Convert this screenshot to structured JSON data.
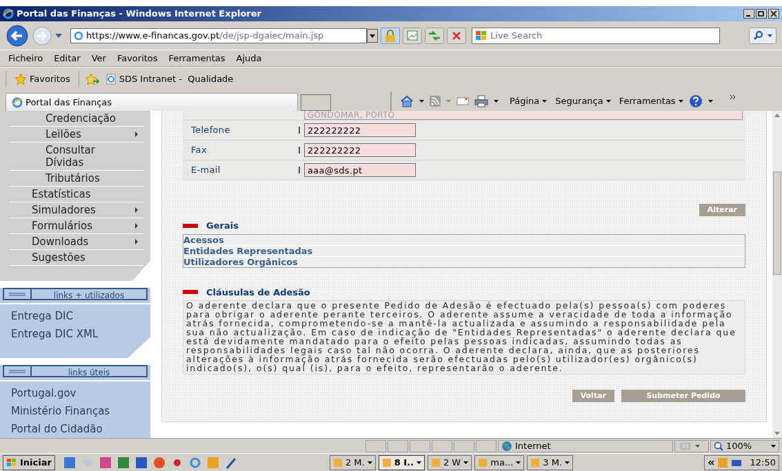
{
  "window": {
    "title": "Portal das Finanças - Windows Internet Explorer"
  },
  "address": {
    "url_host": "https://www.e-financas.gov.pt",
    "url_path": "/de/jsp-dgaiec/main.jsp"
  },
  "search": {
    "placeholder": "Live Search"
  },
  "menu": [
    "Ficheiro",
    "Editar",
    "Ver",
    "Favoritos",
    "Ferramentas",
    "Ajuda"
  ],
  "favorites_bar": {
    "favorites": "Favoritos",
    "links": [
      "SDS Intranet -  Qualidade"
    ]
  },
  "tab": {
    "title": "Portal das Finanças"
  },
  "command_bar": [
    "Página",
    "Segurança",
    "Ferramentas"
  ],
  "sidebar": {
    "items": [
      {
        "label": "Credenciação",
        "kind": "sub",
        "has_submenu": false
      },
      {
        "label": "Leilões",
        "kind": "sub",
        "has_submenu": true
      },
      {
        "label": "Consultar Dívidas",
        "kind": "sub",
        "has_submenu": false
      },
      {
        "label": "Tributários",
        "kind": "sub",
        "has_submenu": false
      },
      {
        "label": "Estatísticas",
        "kind": "main",
        "has_submenu": false
      },
      {
        "label": "Simuladores",
        "kind": "main",
        "has_submenu": true
      },
      {
        "label": "Formulários",
        "kind": "main",
        "has_submenu": true
      },
      {
        "label": "Downloads",
        "kind": "main",
        "has_submenu": true
      },
      {
        "label": "Sugestões",
        "kind": "main",
        "has_submenu": false
      }
    ],
    "link_groups": [
      {
        "title": "links + utilizados",
        "links": [
          "Entrega DIC",
          "Entrega DIC XML"
        ]
      },
      {
        "title": "links úteis",
        "links": [
          "Portugal.gov",
          "Ministério Finanças",
          "Portal do Cidadão"
        ]
      }
    ]
  },
  "form": {
    "partial_value": "GONDOMAR, PORTO",
    "rows": [
      {
        "label": "Telefone",
        "value": "222222222"
      },
      {
        "label": "Fax",
        "value": "222222222"
      },
      {
        "label": "E-mail",
        "value": "aaa@sds.pt"
      }
    ],
    "button": "Alterar"
  },
  "general": {
    "title": "Gerais",
    "links": [
      "Acessos",
      "Entidades Representadas",
      "Utilizadores Orgânicos"
    ]
  },
  "clauses": {
    "title": "Cláusulas de Adesão",
    "text": "O aderente declara que o presente Pedido de Adesão é efectuado pela(s) pessoa(s) com poderes para obrigar o aderente perante terceiros. O aderente assume a veracidade de toda a informação atrás fornecida, comprometendo-se a mantê-la actualizada e assumindo a responsabilidade pela sua não actualização. Em caso de indicação de \"Entidades Representadas\" o aderente declara que está devidamente mandatado para o efeito pelas pessoas indicadas, assumindo todas as responsabilidades legais caso tal não ocorra. O aderente declara, ainda, que as posteriores alterações à informação atrás fornecida serão efectuadas pelo(s) utilizador(es) orgânico(s) indicado(s), o(s) qual (is), para o efeito, representarão o aderente."
  },
  "actions": [
    "Voltar",
    "Submeter Pedido"
  ],
  "status_bar": {
    "zone": "Internet",
    "zoom": "100%"
  },
  "taskbar": {
    "start": "Iniciar",
    "tasks": [
      {
        "label": "2 M.",
        "selected": false
      },
      {
        "label": "8 I..",
        "selected": true
      },
      {
        "label": "2 W",
        "selected": false
      },
      {
        "label": "ma...",
        "selected": false
      },
      {
        "label": "3 M.",
        "selected": false
      }
    ],
    "clock": "12:50"
  }
}
